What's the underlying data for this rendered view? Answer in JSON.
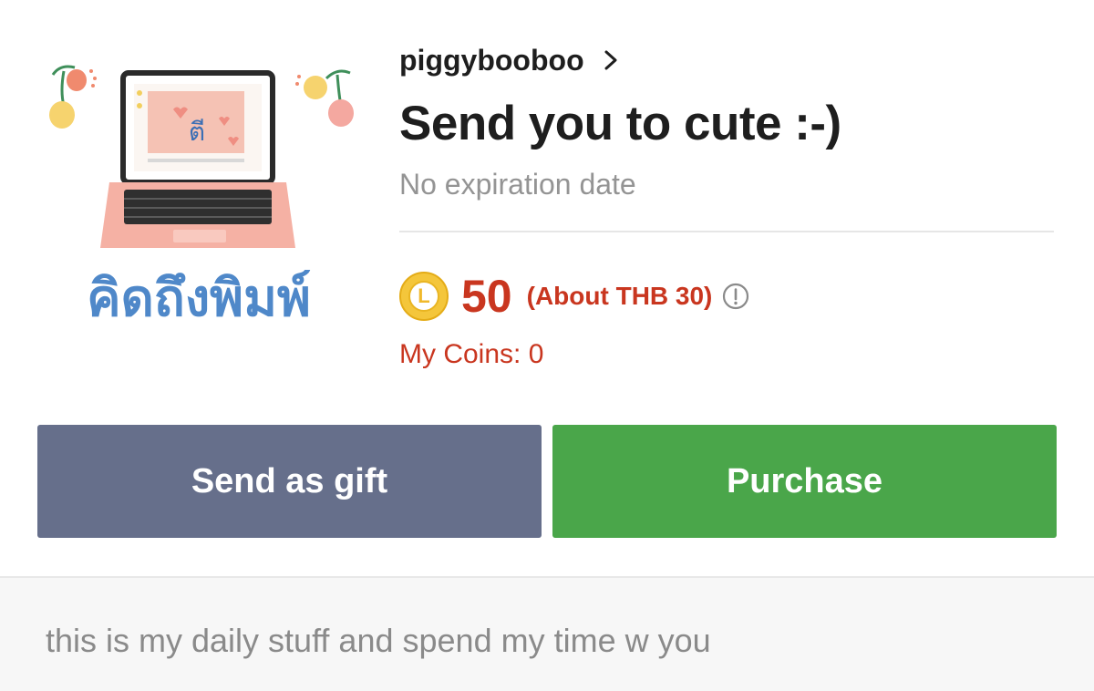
{
  "product": {
    "author": "piggybooboo",
    "title": "Send you to cute :-)",
    "expiry": "No expiration date",
    "thumbnail_caption": "คิดถึงพิมพ์",
    "screen_text": "ตี"
  },
  "price": {
    "coin_letter": "L",
    "coins": "50",
    "approx": "(About THB 30)",
    "my_coins": "My Coins: 0"
  },
  "actions": {
    "gift_label": "Send as gift",
    "purchase_label": "Purchase"
  },
  "description": "this is my daily stuff and spend my time w you",
  "colors": {
    "price_red": "#c9361f",
    "gift_button": "#666f8b",
    "purchase_button": "#4aa64a",
    "coin_gold": "#f4c63b"
  }
}
